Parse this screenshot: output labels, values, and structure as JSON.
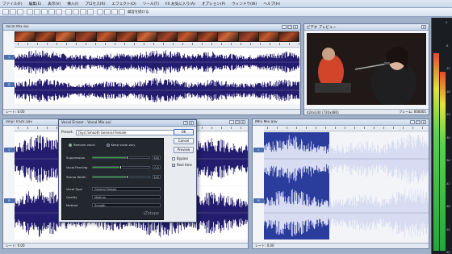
{
  "menubar": {
    "items": [
      "ファイル(F)",
      "編集(E)",
      "表示(V)",
      "挿入(I)",
      "プロセス(R)",
      "エフェクト(O)",
      "ツール(T)",
      "FX お気に入り(A)",
      "オプション(P)",
      "ウィンドウ(W)",
      "ヘルプ(H)"
    ]
  },
  "toolbar": {
    "label": "録音を続ける"
  },
  "windows": {
    "vocal_mix": {
      "title": "Vocal Mix.avi",
      "status": "レート: 0.00"
    },
    "video_preview": {
      "title": "ビデオ プレビュー",
      "status_left": "424x240 (720x480)",
      "status_right": "フレーム: 000001"
    },
    "vinyl_track": {
      "title": "Vinyl Track.aav",
      "status": "レート: 0.00"
    },
    "mp3_mix": {
      "title": "MP3 Mix.aav",
      "status": "レート: 0.00"
    }
  },
  "dialog": {
    "title": "Vocal Eraser - Vocal Mix.avi",
    "preset_label": "Preset:",
    "preset_value": "[Sys] Smooth General Female",
    "buttons": {
      "ok": "OK",
      "cancel": "Cancel",
      "preview": "Preview"
    },
    "checks": {
      "bypass": "Bypass",
      "realtime": "Real time"
    },
    "radios": {
      "remove": "Remove vocal",
      "keep": "Keep vocal only"
    },
    "params": [
      {
        "label": "Suppression",
        "value": "100",
        "level": 0.62
      },
      {
        "label": "Vocal Panning",
        "value": "0.0",
        "level": 0.5
      },
      {
        "label": "Stereo Width",
        "value": "100",
        "level": 0.62
      }
    ],
    "selects": [
      {
        "label": "Vocal Type",
        "value": "General Female"
      },
      {
        "label": "Quality",
        "value": "Medium"
      },
      {
        "label": "Method",
        "value": "Smooth"
      }
    ],
    "brand": "iZotope"
  },
  "colors": {
    "wave": "#241c6e",
    "wave_selected_bg": "#2a3c9c",
    "meter_green": "#1fa83a"
  },
  "meter": {
    "levels": [
      0.86,
      0.78
    ],
    "scale": [
      "0",
      "-6",
      "-12",
      "-18",
      "-24",
      "-30",
      "-36",
      "-42",
      "-48",
      "-54",
      "-60"
    ]
  }
}
